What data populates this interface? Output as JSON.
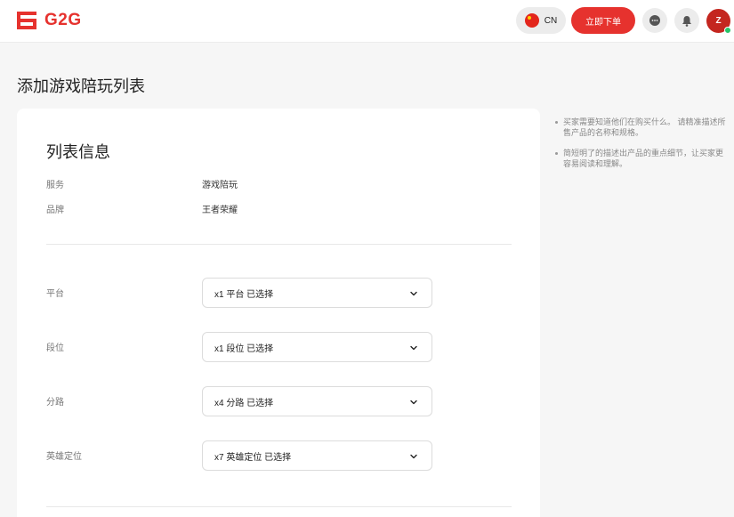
{
  "header": {
    "logo_text": "G2G",
    "brand_color": "#e6322e",
    "language_label": "CN",
    "cta_label": "立即下单",
    "avatar_initial": "Z"
  },
  "page": {
    "title": "添加游戏陪玩列表"
  },
  "listing": {
    "section_title": "列表信息",
    "info": [
      {
        "label": "服务",
        "value": "游戏陪玩"
      },
      {
        "label": "品牌",
        "value": "王者荣耀"
      }
    ],
    "fields": [
      {
        "label": "平台",
        "value": "x1 平台 已选择"
      },
      {
        "label": "段位",
        "value": "x1 段位 已选择"
      },
      {
        "label": "分路",
        "value": "x4 分路 已选择"
      },
      {
        "label": "英雄定位",
        "value": "x7 英雄定位 已选择"
      }
    ]
  },
  "tips": [
    "买家需要知道他们在购买什么。 请精准描述所售产品的名称和规格。",
    "简短明了的描述出产品的重点细节，让买家更容易阅读和理解。"
  ]
}
